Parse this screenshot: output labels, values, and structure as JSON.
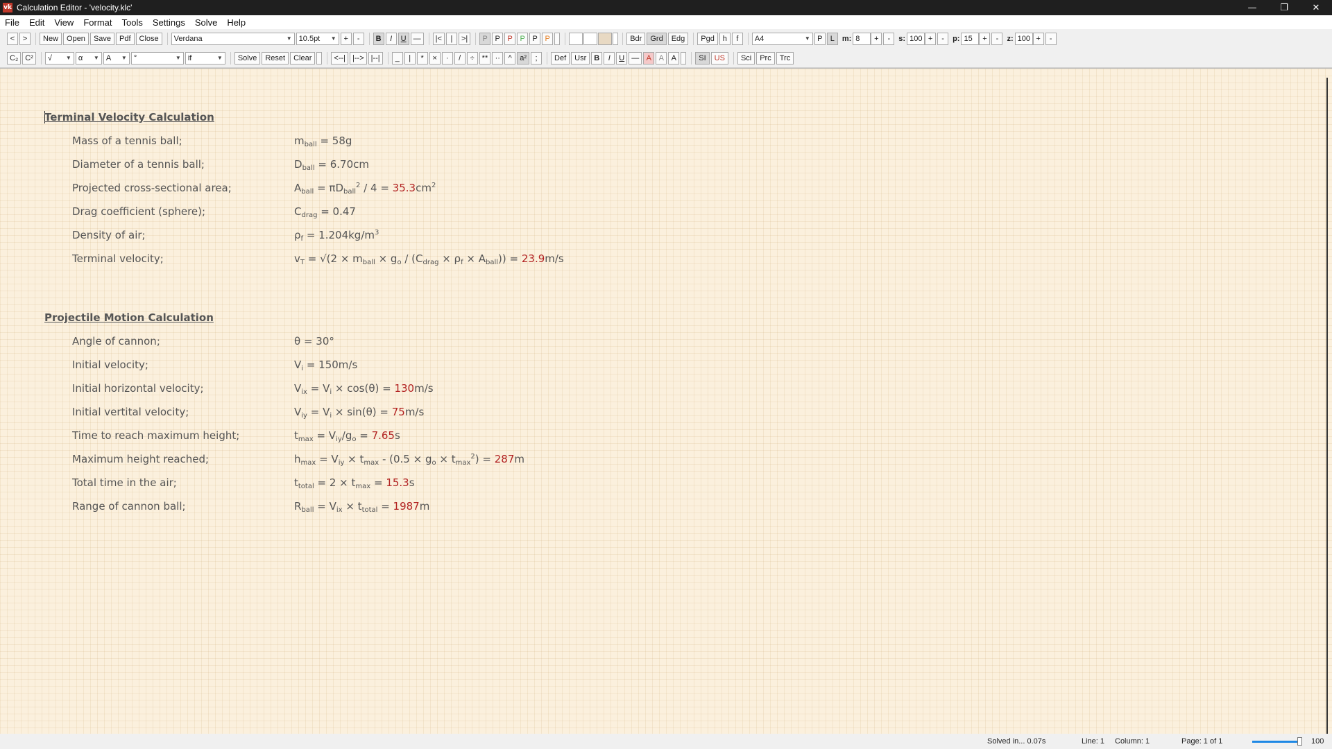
{
  "window": {
    "title": "Calculation Editor  -  'velocity.klc'",
    "icon": "vk"
  },
  "menu": [
    "File",
    "Edit",
    "View",
    "Format",
    "Tools",
    "Settings",
    "Solve",
    "Help"
  ],
  "toolbar1": {
    "prev": "<",
    "next": ">",
    "new": "New",
    "open": "Open",
    "save": "Save",
    "pdf": "Pdf",
    "close": "Close",
    "font": "Verdana",
    "font_size": "10.5pt",
    "bold": "B",
    "italic": "I",
    "underline": "U",
    "strike": "—",
    "align_left": "|<",
    "align_center": "|",
    "align_right": ">|",
    "p_buttons": [
      "P",
      "P",
      "P",
      "P",
      "P",
      "P"
    ],
    "bdr": "Bdr",
    "grd": "Grd",
    "edg": "Edg",
    "pgd": "Pgd",
    "h": "h",
    "f": "f",
    "paper": "A4",
    "portrait": "P",
    "landscape": "L",
    "m_label": "m:",
    "m_value": "8",
    "s_label": "s:",
    "s_value": "100",
    "p_label": "p:",
    "p_value": "15",
    "z_label": "z:",
    "z_value": "100"
  },
  "toolbar2": {
    "sub": "C₂",
    "sup": "C²",
    "sqrt": "√",
    "alpha": "α",
    "A_combo": "A",
    "degree": "°",
    "if_combo": "if",
    "solve": "Solve",
    "reset": "Reset",
    "clear": "Clear",
    "ops": [
      "<--|",
      "|-->",
      "|--|",
      "_",
      "|",
      "*",
      "×",
      "·",
      "/",
      "÷",
      "**",
      "··",
      "^",
      "a²",
      ";"
    ],
    "def": "Def",
    "usr": "Usr",
    "b": "B",
    "i": "I",
    "u": "U",
    "strike": "—",
    "a1": "A",
    "a2": "A",
    "a3": "A",
    "si": "SI",
    "us": "US",
    "sci": "Sci",
    "prc": "Prc",
    "trc": "Trc"
  },
  "doc": {
    "sec1_title": "Terminal Velocity Calculation",
    "r1_desc": "Mass of a tennis ball;",
    "r1_eq": "m<sub>ball</sub> = 58g",
    "r2_desc": "Diameter of a tennis ball;",
    "r2_eq": "D<sub>ball</sub> = 6.70cm",
    "r3_desc": "Projected cross-sectional area;",
    "r3_eq": "A<sub>ball</sub> = πD<sub>ball</sub><sup>2</sup> / 4 = <span class='res'>35.3</span>cm<sup>2</sup>",
    "r4_desc": "Drag coefficient (sphere);",
    "r4_eq": "C<sub>drag</sub> = 0.47",
    "r5_desc": "Density of air;",
    "r5_eq": "ρ<sub>f</sub> = 1.204kg/m<sup>3</sup>",
    "r6_desc": "Terminal velocity;",
    "r6_eq": "v<sub>T</sub> = √(2 × m<sub>ball</sub> × g<sub>o</sub> / (C<sub>drag</sub> × ρ<sub>f</sub> × A<sub>ball</sub>)) = <span class='res'>23.9</span>m/s",
    "sec2_title": "Projectile Motion Calculation",
    "p1_desc": "Angle of cannon;",
    "p1_eq": "θ = 30°",
    "p2_desc": "Initial velocity;",
    "p2_eq": "V<sub>i</sub> = 150m/s",
    "p3_desc": "Initial horizontal velocity;",
    "p3_eq": "V<sub>ix</sub> = V<sub>i</sub> × cos(θ) = <span class='res'>130</span>m/s",
    "p4_desc": "Initial vertital velocity;",
    "p4_eq": "V<sub>iy</sub> = V<sub>i</sub> × sin(θ) = <span class='res'>75</span>m/s",
    "p5_desc": "Time to reach maximum height;",
    "p5_eq": "t<sub>max</sub> = V<sub>iy</sub>/g<sub>o</sub> = <span class='res'>7.65</span>s",
    "p6_desc": "Maximum height reached;",
    "p6_eq": "h<sub>max</sub> = V<sub>iy</sub> × t<sub>max</sub> - (0.5 × g<sub>o</sub> × t<sub>max</sub><sup>2</sup>) = <span class='res'>287</span>m",
    "p7_desc": "Total time in the air;",
    "p7_eq": "t<sub>total</sub> = 2 × t<sub>max</sub> = <span class='res'>15.3</span>s",
    "p8_desc": "Range of cannon ball;",
    "p8_eq": "R<sub>ball</sub> = V<sub>ix</sub> × t<sub>total</sub> = <span class='res'>1987</span>m"
  },
  "status": {
    "solved": "Solved in... 0.07s",
    "line": "Line: 1",
    "column": "Column: 1",
    "page": "Page: 1 of 1",
    "zoom": "100",
    "zoom_level": 1.0
  }
}
